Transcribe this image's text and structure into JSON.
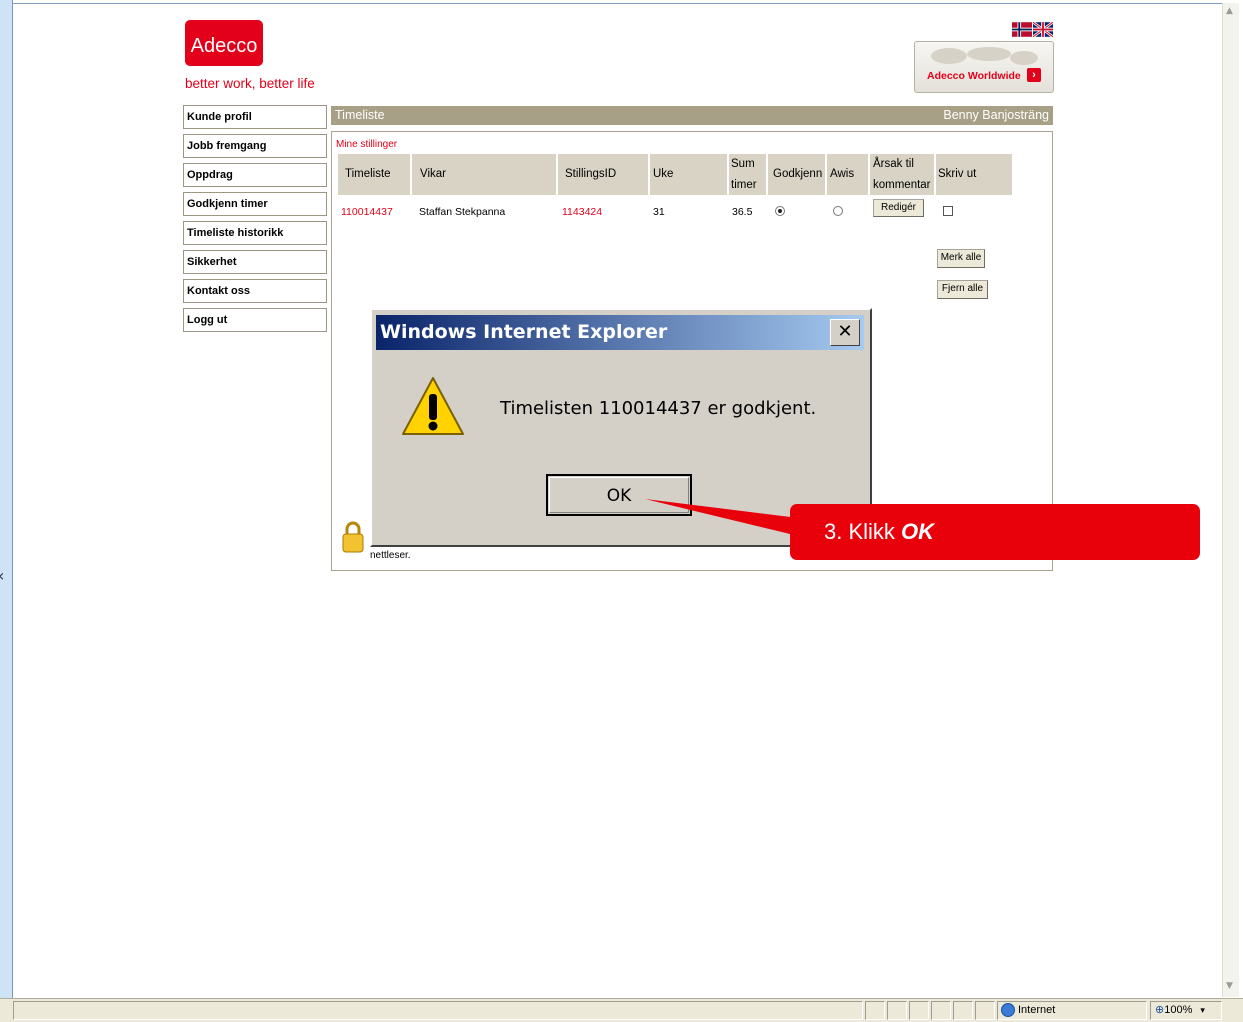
{
  "brand": {
    "logo_text": "Adecco",
    "tagline": "better work, better life",
    "worldwide_label": "Adecco Worldwide",
    "flags": [
      "flag-no",
      "flag-uk"
    ],
    "color": "#e2001a"
  },
  "nav": {
    "items": [
      {
        "label": "Kunde profil"
      },
      {
        "label": "Jobb fremgang"
      },
      {
        "label": "Oppdrag"
      },
      {
        "label": "Godkjenn timer"
      },
      {
        "label": "Timeliste historikk"
      },
      {
        "label": "Sikkerhet"
      },
      {
        "label": "Kontakt oss"
      },
      {
        "label": "Logg ut"
      }
    ]
  },
  "header": {
    "title": "Timeliste",
    "user": "Benny Banjosträng"
  },
  "section_label": "Mine stillinger",
  "table": {
    "columns": [
      "Timeliste",
      "Vikar",
      "StillingsID",
      "Uke",
      "Sum timer",
      "Godkjenn",
      "Awis",
      "Årsak til kommentar",
      "Skriv ut"
    ],
    "col_sum_1": "Sum",
    "col_sum_2": "timer",
    "col_arsak_1": "Årsak til",
    "col_arsak_2": "kommentar",
    "rows": [
      {
        "timeliste": "110014437",
        "vikar": "Staffan Stekpanna",
        "stillingsid": "1143424",
        "uke": "31",
        "sum_timer": "36.5",
        "godkjenn": true,
        "awis": false,
        "edit_label": "Redigér",
        "skriv_ut": false
      }
    ]
  },
  "buttons": {
    "mark_all": "Merk alle",
    "remove_all": "Fjern alle"
  },
  "footer_text": "nettleser.",
  "dialog": {
    "title": "Windows Internet Explorer",
    "message": "Timelisten  110014437   er godkjent.",
    "ok": "OK",
    "close": "✕"
  },
  "callout": {
    "prefix": "3. Klikk ",
    "emphasis": "OK",
    "color": "#e8000b"
  },
  "statusbar": {
    "zone": "Internet",
    "zoom": "100%"
  }
}
